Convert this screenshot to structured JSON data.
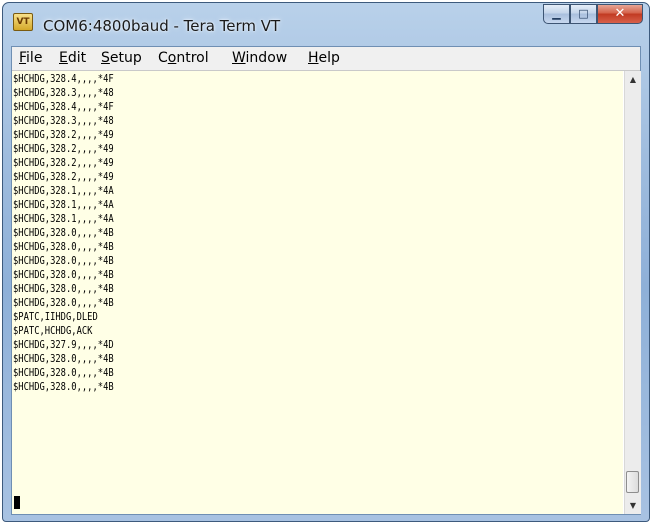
{
  "window": {
    "title": "COM6:4800baud - Tera Term VT",
    "app_icon_label": "VT",
    "minimize_glyph": "▁",
    "maximize_glyph": "□",
    "close_glyph": "✕"
  },
  "menu": [
    {
      "accel": "F",
      "rest": "ile"
    },
    {
      "accel": "E",
      "rest": "dit"
    },
    {
      "accel": "S",
      "rest": "etup"
    },
    {
      "accel": "",
      "pre": "C",
      "accel_mid": "o",
      "rest": "ntrol"
    },
    {
      "accel": "W",
      "rest": "indow"
    },
    {
      "accel": "H",
      "rest": "elp"
    }
  ],
  "terminal_lines": [
    "$HCHDG,328.4,,,,*4F",
    "$HCHDG,328.3,,,,*48",
    "$HCHDG,328.4,,,,*4F",
    "$HCHDG,328.3,,,,*48",
    "$HCHDG,328.2,,,,*49",
    "$HCHDG,328.2,,,,*49",
    "$HCHDG,328.2,,,,*49",
    "$HCHDG,328.2,,,,*49",
    "$HCHDG,328.1,,,,*4A",
    "$HCHDG,328.1,,,,*4A",
    "$HCHDG,328.1,,,,*4A",
    "$HCHDG,328.0,,,,*4B",
    "$HCHDG,328.0,,,,*4B",
    "$HCHDG,328.0,,,,*4B",
    "$HCHDG,328.0,,,,*4B",
    "$HCHDG,328.0,,,,*4B",
    "$HCHDG,328.0,,,,*4B",
    "$PATC,IIHDG,DLED",
    "$PATC,HCHDG,ACK",
    "$HCHDG,327.9,,,,*4D",
    "$HCHDG,328.0,,,,*4B",
    "$HCHDG,328.0,,,,*4B",
    "$HCHDG,328.0,,,,*4B"
  ],
  "scrollbar": {
    "up_glyph": "▲",
    "down_glyph": "▼"
  },
  "colors": {
    "terminal_background": "#ffffe6",
    "terminal_text": "#000000"
  }
}
